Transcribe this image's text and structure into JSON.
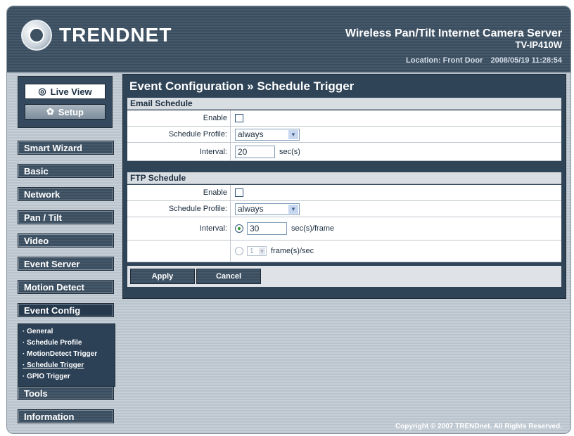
{
  "header": {
    "logo_text": "TRENDNET",
    "product_name": "Wireless Pan/Tilt Internet Camera Server",
    "product_model": "TV-IP410W",
    "location": "Location: Front Door",
    "datetime": "2008/05/19 11:28:54"
  },
  "view_box": {
    "live_view_label": "Live View",
    "setup_label": "Setup"
  },
  "nav": {
    "smart_wizard": "Smart Wizard",
    "basic": "Basic",
    "network": "Network",
    "pan_tilt": "Pan / Tilt",
    "video": "Video",
    "event_server": "Event Server",
    "motion_detect": "Motion Detect",
    "event_config": "Event Config",
    "tools": "Tools",
    "information": "Information",
    "submenu": [
      "· General",
      "· Schedule Profile",
      "· MotionDetect Trigger",
      "· Schedule Trigger",
      "· GPIO Trigger"
    ]
  },
  "panel": {
    "title": "Event Configuration » Schedule Trigger",
    "email": {
      "heading": "Email Schedule",
      "enable_label": "Enable",
      "enable_checked": false,
      "profile_label": "Schedule Profile:",
      "profile_value": "always",
      "interval_label": "Interval:",
      "interval_value": "20",
      "interval_unit": "sec(s)"
    },
    "ftp": {
      "heading": "FTP Schedule",
      "enable_label": "Enable",
      "enable_checked": false,
      "profile_label": "Schedule Profile:",
      "profile_value": "always",
      "interval_label": "Interval:",
      "interval_value": "30",
      "interval_unit": "sec(s)/frame",
      "rate_value": "1",
      "rate_unit": "frame(s)/sec"
    },
    "apply_label": "Apply",
    "cancel_label": "Cancel"
  },
  "footer": {
    "copyright": "Copyright © 2007 TRENDnet. All Rights Reserved."
  }
}
